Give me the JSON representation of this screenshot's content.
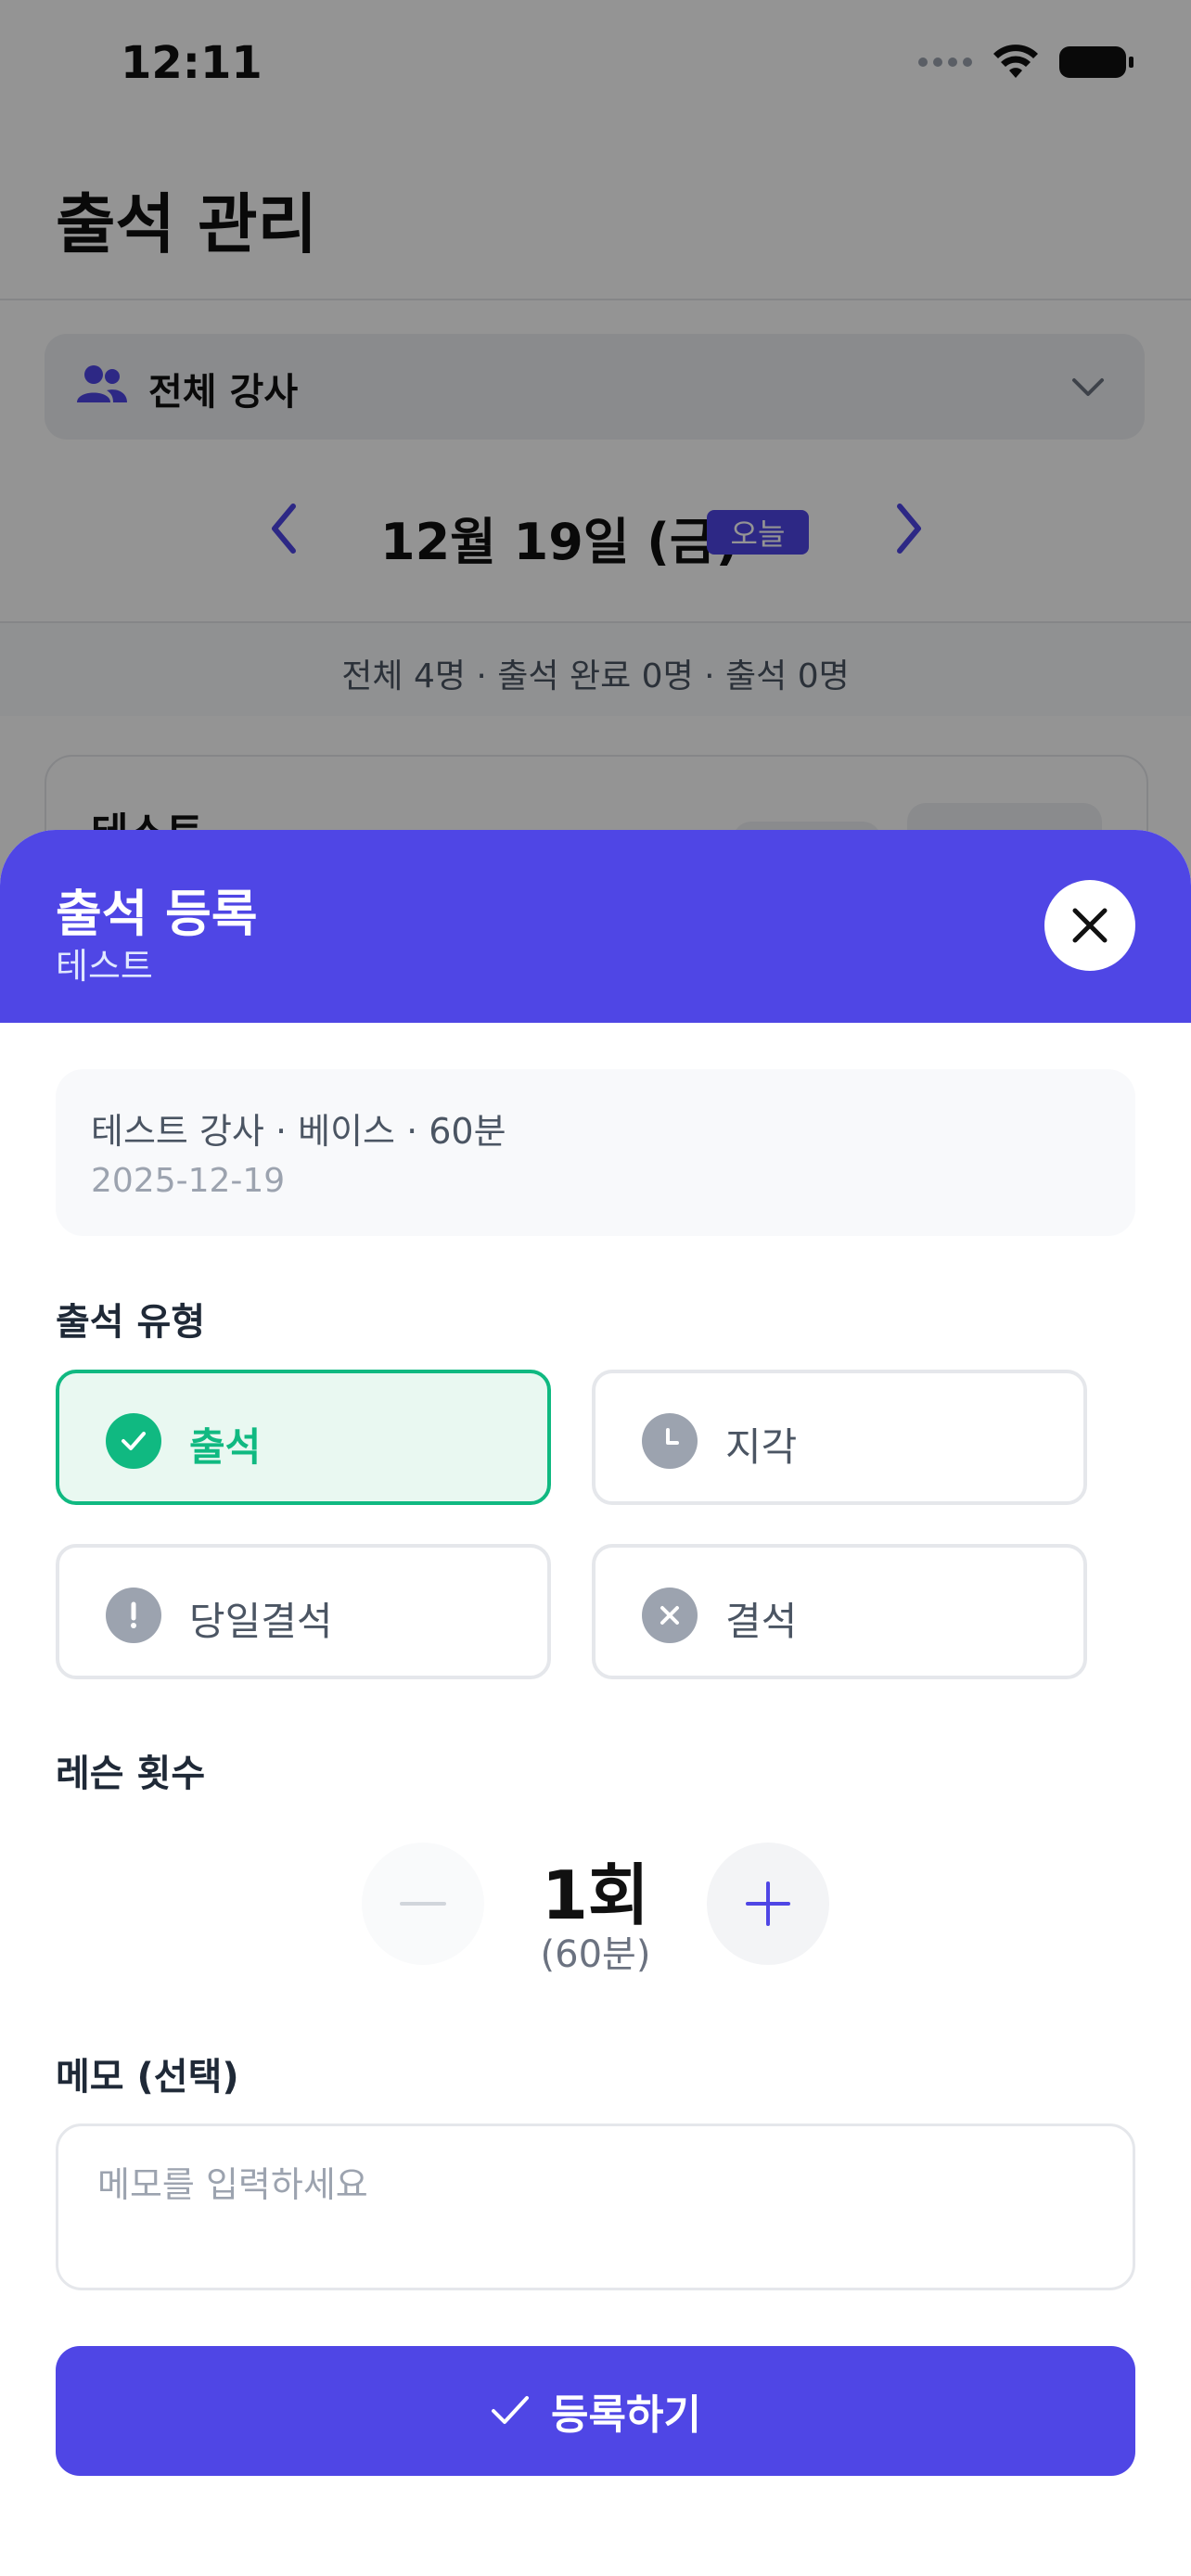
{
  "status_bar": {
    "time": "12:11"
  },
  "page": {
    "title": "출석 관리",
    "teacher_filter": "전체 강사",
    "date": "12월 19일 (금)",
    "today_badge": "오늘",
    "summary": "전체 4명 · 출석 완료 0명 · 출석 0명",
    "student_name": "테스트"
  },
  "modal": {
    "title": "출석 등록",
    "subtitle": "테스트",
    "info_line": "테스트 강사 · 베이스 · 60분",
    "info_date": "2025-12-19",
    "type_section_label": "출석 유형",
    "types": [
      {
        "label": "출석",
        "icon": "check-circle-icon",
        "selected": true
      },
      {
        "label": "지각",
        "icon": "clock-icon",
        "selected": false
      },
      {
        "label": "당일결석",
        "icon": "exclamation-icon",
        "selected": false
      },
      {
        "label": "결석",
        "icon": "x-circle-icon",
        "selected": false
      }
    ],
    "lesson_section_label": "레슨 횟수",
    "lesson_count": "1회",
    "lesson_duration": "(60분)",
    "memo_section_label": "메모 (선택)",
    "memo_placeholder": "메모를 입력하세요",
    "submit_label": "등록하기"
  },
  "colors": {
    "accent": "#4f46e5",
    "success": "#10b981",
    "muted_icon": "#9ca3af"
  }
}
